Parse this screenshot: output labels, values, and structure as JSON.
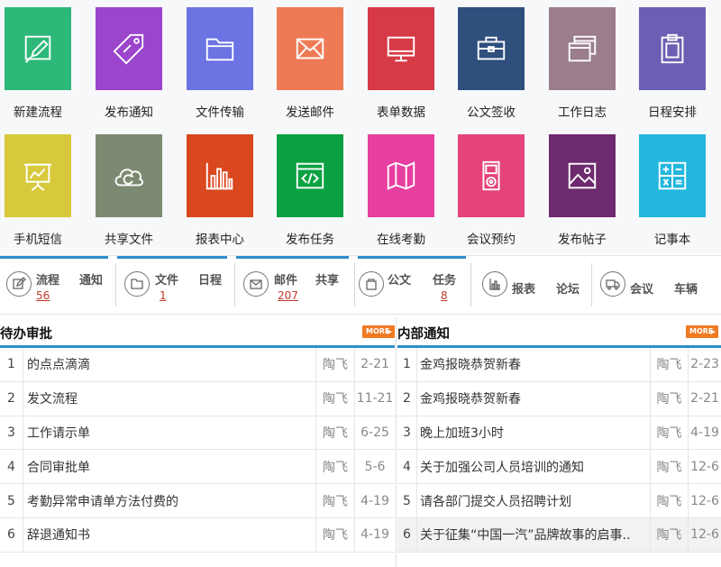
{
  "tiles": [
    {
      "label": "新建流程",
      "color": "#2db87a",
      "icon": "edit-icon"
    },
    {
      "label": "发布通知",
      "color": "#9b45cc",
      "icon": "tag-icon"
    },
    {
      "label": "文件传输",
      "color": "#6c73e3",
      "icon": "folder-icon"
    },
    {
      "label": "发送邮件",
      "color": "#ee7a55",
      "icon": "mail-icon"
    },
    {
      "label": "表单数据",
      "color": "#d63a46",
      "icon": "monitor-icon"
    },
    {
      "label": "公文签收",
      "color": "#2f4f7d",
      "icon": "briefcase-icon"
    },
    {
      "label": "工作日志",
      "color": "#9b7d8c",
      "icon": "windows-icon"
    },
    {
      "label": "日程安排",
      "color": "#6a5fb3",
      "icon": "clipboard-icon"
    },
    {
      "label": "手机短信",
      "color": "#d7c93b",
      "icon": "chart-board-icon"
    },
    {
      "label": "共享文件",
      "color": "#7d8a72",
      "icon": "cloud-sync-icon"
    },
    {
      "label": "报表中心",
      "color": "#d9481f",
      "icon": "bar-chart-icon"
    },
    {
      "label": "发布任务",
      "color": "#0aa142",
      "icon": "code-window-icon"
    },
    {
      "label": "在线考勤",
      "color": "#e63fa0",
      "icon": "map-icon"
    },
    {
      "label": "会议预约",
      "color": "#e4437c",
      "icon": "ipod-icon"
    },
    {
      "label": "发布帖子",
      "color": "#6e2a6e",
      "icon": "image-icon"
    },
    {
      "label": "记事本",
      "color": "#23b7dd",
      "icon": "calculator-icon"
    }
  ],
  "stats": {
    "flow": {
      "label": "流程",
      "count": "56",
      "extra": "通知"
    },
    "file": {
      "label": "文件",
      "count": "1",
      "extra": "日程"
    },
    "mail": {
      "label": "邮件",
      "count": "207",
      "extra": "共享"
    },
    "doc": {
      "label": "公文",
      "extra": "任务",
      "extra_count": "8"
    },
    "report": {
      "label": "报表",
      "extra": "论坛"
    },
    "meeting": {
      "label": "会议",
      "extra": "车辆"
    }
  },
  "pending": {
    "title": "待办审批",
    "more": "MORE",
    "rows": [
      {
        "num": "1",
        "title": "的点点滴滴",
        "author": "陶飞",
        "date": "2-21"
      },
      {
        "num": "2",
        "title": "发文流程",
        "author": "陶飞",
        "date": "11-21"
      },
      {
        "num": "3",
        "title": "工作请示单",
        "author": "陶飞",
        "date": "6-25"
      },
      {
        "num": "4",
        "title": "合同审批单",
        "author": "陶飞",
        "date": "5-6"
      },
      {
        "num": "5",
        "title": "考勤异常申请单方法付费的",
        "author": "陶飞",
        "date": "4-19"
      },
      {
        "num": "6",
        "title": "辞退通知书",
        "author": "陶飞",
        "date": "4-19"
      }
    ]
  },
  "notices": {
    "title": "内部通知",
    "more": "MORE",
    "rows": [
      {
        "num": "1",
        "title": "金鸡报晓恭贺新春",
        "author": "陶飞",
        "date": "2-23"
      },
      {
        "num": "2",
        "title": "金鸡报晓恭贺新春",
        "author": "陶飞",
        "date": "2-21"
      },
      {
        "num": "3",
        "title": "晚上加班3小时",
        "author": "陶飞",
        "date": "4-19"
      },
      {
        "num": "4",
        "title": "关于加强公司人员培训的通知",
        "author": "陶飞",
        "date": "12-6"
      },
      {
        "num": "5",
        "title": "请各部门提交人员招聘计划",
        "author": "陶飞",
        "date": "12-6"
      },
      {
        "num": "6",
        "title": "关于征集“中国一汽”品牌故事的启事..",
        "author": "陶飞",
        "date": "12-6"
      }
    ]
  },
  "colors": {
    "accent": "#2c8ec9",
    "more": "#f07a22",
    "count": "#c0392b"
  }
}
